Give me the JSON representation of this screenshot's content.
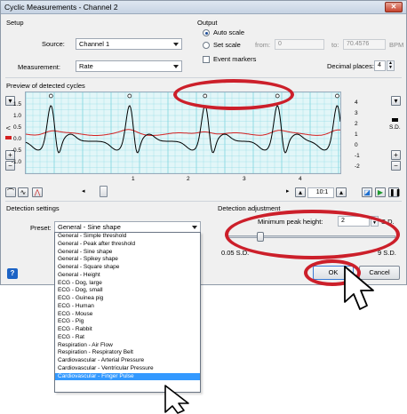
{
  "window": {
    "title": "Cyclic Measurements - Channel 2",
    "close_label": "✕"
  },
  "setup": {
    "group_label": "Setup",
    "source_label": "Source:",
    "source_value": "Channel 1",
    "measurement_label": "Measurement:",
    "measurement_value": "Rate"
  },
  "output": {
    "group_label": "Output",
    "auto_scale_label": "Auto scale",
    "set_scale_label": "Set scale",
    "from_label": "from:",
    "from_value": "0",
    "to_label": "to:",
    "to_value": "70.4576",
    "unit": "BPM",
    "event_markers_label": "Event markers",
    "decimal_places_label": "Decimal places:",
    "decimal_places_value": "4",
    "scale_mode": "auto"
  },
  "preview": {
    "group_label": "Preview of detected cycles",
    "left_axis_unit": "V",
    "right_axis_unit": "S.D.",
    "y_ticks": [
      "1.5",
      "1.0",
      "0.5",
      "0.0",
      "-0.5",
      "-1.0"
    ],
    "right_ticks": [
      "4",
      "3",
      "2",
      "1",
      "0",
      "-1",
      "-2"
    ],
    "x_ticks": [
      "1",
      "2",
      "3",
      "4"
    ],
    "zoom_value": "10:1",
    "signal_color": "#000000",
    "threshold_color": "#d42020",
    "grid_color": "#7fd6e0",
    "peaks_x": [
      0.08,
      0.33,
      0.57,
      0.8,
      0.99
    ]
  },
  "detection_settings": {
    "group_label": "Detection settings",
    "preset_label": "Preset:",
    "preset_value": "General - Sine shape",
    "preset_options": [
      "General - Simple threshold",
      "General - Peak after threshold",
      "General - Sine shape",
      "General - Spikey shape",
      "General - Square shape",
      "General - Height",
      "ECG - Dog, large",
      "ECG - Dog, small",
      "ECG - Guinea pig",
      "ECG - Human",
      "ECG - Mouse",
      "ECG - Pig",
      "ECG - Rabbit",
      "ECG - Rat",
      "Respiration - Air Flow",
      "Respiration - Respiratory Belt",
      "Cardiovascular - Arterial Pressure",
      "Cardiovascular - Ventricular Pressure",
      "Cardiovascular - Finger Pulse"
    ],
    "highlighted_option": "Cardiovascular - Finger Pulse"
  },
  "detection_adjustment": {
    "group_label": "Detection adjustment",
    "min_peak_label": "Minimum peak height:",
    "min_peak_value": "2",
    "min_peak_unit": "S.D.",
    "slider_min_label": "0.05 S.D.",
    "slider_max_label": "9 S.D.",
    "slider_level": 0.2
  },
  "footer": {
    "help_label": "?",
    "ok_label": "OK",
    "cancel_label": "Cancel"
  },
  "colors": {
    "annotation_ellipse": "#cc1f2a",
    "selection": "#3399ff"
  }
}
